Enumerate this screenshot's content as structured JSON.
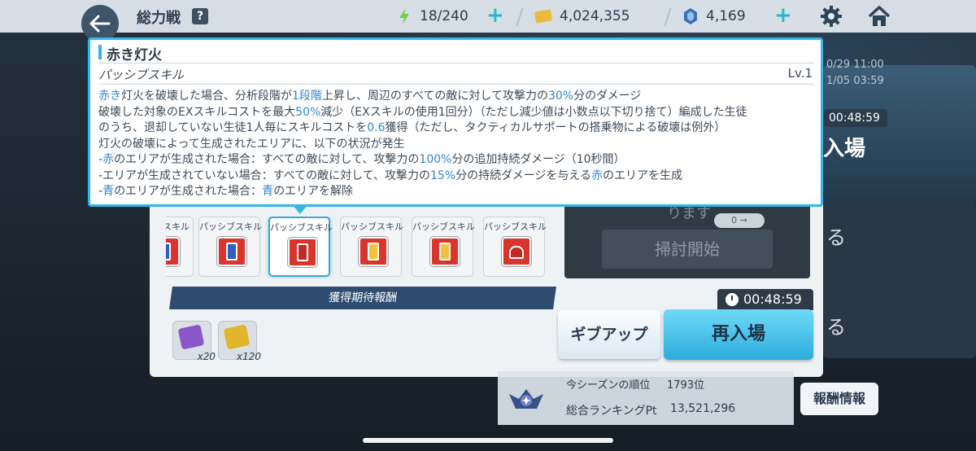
{
  "header": {
    "title": "総力戦",
    "help_glyph": "?",
    "stamina": "18/240",
    "credits": "4,024,355",
    "pyroxene": "4,169",
    "plus_glyph": "+"
  },
  "background": {
    "date_start": "0/29 11:00",
    "date_end": "1/05 03:59",
    "timer": "00:48:59",
    "reenter_partial": "入場",
    "side_glyph": "る"
  },
  "tooltip": {
    "title": "赤き灯火",
    "type": "パッシブスキル",
    "level": "Lv.1",
    "lines": [
      [
        {
          "t": "赤き",
          "hl": true
        },
        {
          "t": "灯火を破壊した場合、分析段階が"
        },
        {
          "t": "1段階",
          "hl": true
        },
        {
          "t": "上昇し、周辺のすべての敵に対して攻撃力の"
        },
        {
          "t": "30%",
          "hl": true
        },
        {
          "t": "分のダメージ"
        }
      ],
      [
        {
          "t": "破壊した対象のEXスキルコストを最大"
        },
        {
          "t": "50%",
          "hl": true
        },
        {
          "t": "減少（EXスキルの使用1回分）（ただし減少値は小数点以下切り捨て）編成した生徒"
        }
      ],
      [
        {
          "t": "のうち、退却していない生徒1人毎にスキルコストを"
        },
        {
          "t": "0.6",
          "hl": true
        },
        {
          "t": "獲得（ただし、タクティカルサポートの搭乗物による破壊は例外）"
        }
      ],
      [
        {
          "t": "灯火の破壊によって生成されたエリアに、以下の状況が発生"
        }
      ],
      [
        {
          "t": "-"
        },
        {
          "t": "赤",
          "hl": true
        },
        {
          "t": "のエリアが生成された場合：すべての敵に対して、攻撃力の"
        },
        {
          "t": "100%",
          "hl": true
        },
        {
          "t": "分の追加持続ダメージ（10秒間）"
        }
      ],
      [
        {
          "t": "-エリアが生成されていない場合：すべての敵に対して、攻撃力の"
        },
        {
          "t": "15%",
          "hl": true
        },
        {
          "t": "分の持続ダメージを与える"
        },
        {
          "t": "赤",
          "hl": true
        },
        {
          "t": "のエリアを生成"
        }
      ],
      [
        {
          "t": "-"
        },
        {
          "t": "青",
          "hl": true
        },
        {
          "t": "のエリアが生成された場合："
        },
        {
          "t": "青",
          "hl": true
        },
        {
          "t": "のエリアを解除"
        }
      ]
    ]
  },
  "skills": {
    "items": [
      {
        "label": "スキル",
        "color": "blue"
      },
      {
        "label": "パッシブスキル",
        "color": "blue"
      },
      {
        "label": "パッシブスキル",
        "color": "red",
        "selected": true
      },
      {
        "label": "パッシブスキル",
        "color": "yellow"
      },
      {
        "label": "パッシブスキル",
        "color": "yellow"
      },
      {
        "label": "パッシブスキル",
        "color": "robo"
      }
    ]
  },
  "rewards": {
    "header": "獲得期待報酬",
    "items": [
      {
        "icon": "purple-gem-icon",
        "color": "#8b56c9",
        "qty": "x20"
      },
      {
        "icon": "gold-gem-icon",
        "color": "#e1b52c",
        "qty": "x120"
      }
    ]
  },
  "actions": {
    "give_up": "ギブアップ",
    "reenter": "再入場",
    "timer": "00:48:59"
  },
  "dark_box": {
    "text": "ります",
    "button": "掃討開始",
    "bubble": "0 →"
  },
  "ranking": {
    "season_label": "今シーズンの順位",
    "season_value": "1793位",
    "total_label": "総合ランキングPt",
    "total_value": "13,521,296",
    "reward_info": "報酬情報"
  },
  "colors": {
    "accent": "#33b7e6",
    "highlight_text": "#2e86d4",
    "skill_red": "#d9352c"
  }
}
